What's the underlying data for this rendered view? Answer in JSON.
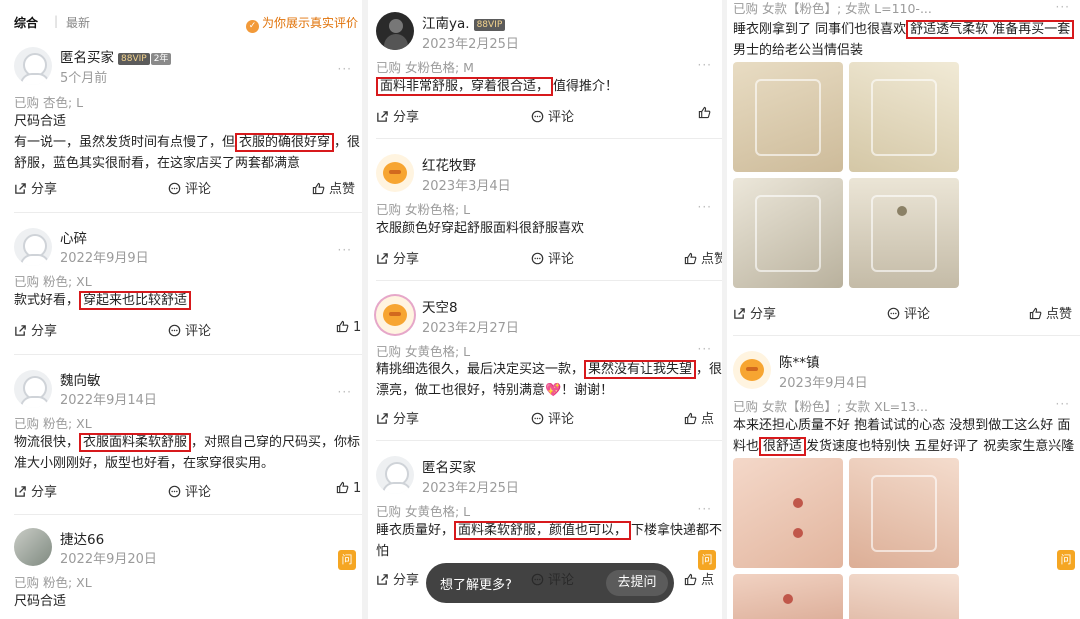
{
  "topbar": {
    "tab_all": "综合",
    "tab_sep": "|",
    "tab_latest": "最新",
    "guarantee": "为你展示真实评价"
  },
  "actions": {
    "share": "分享",
    "comment": "评论",
    "like": "点赞",
    "like_cut": "点赞",
    "like_trunc": "点",
    "like_short": "1"
  },
  "panel1": [
    {
      "user": "匿名买家",
      "vip": "88VIP",
      "vip_level": "2年",
      "date": "5个月前",
      "meta": "已购 杏色; L",
      "line1": "尺码合适",
      "line2_pre": "有一说一，虽然发货时间有点慢了，但",
      "line2_hl": "衣服的确很好穿",
      "line2_post": "，很",
      "line3": "舒服，蓝色其实很耐看，在这家店买了两套都满意"
    },
    {
      "user": "心碎",
      "date": "2022年9月9日",
      "meta": "已购 粉色; XL",
      "line1_pre": "款式好看，",
      "line1_hl": "穿起来也比较舒适"
    },
    {
      "user": "魏向敏",
      "date": "2022年9月14日",
      "meta": "已购 粉色; XL",
      "line1_pre": "物流很快，",
      "line1_hl": "衣服面料柔软舒服",
      "line1_post": "，对照自己穿的尺码买，你标",
      "line2": "准大小刚刚好，版型也好看，在家穿很实用。"
    },
    {
      "user": "捷达66",
      "date": "2022年9月20日",
      "meta": "已购 粉色; XL",
      "line1": "尺码合适"
    }
  ],
  "panel2": [
    {
      "user": "江南ya.",
      "vip": "88VIP",
      "date": "2023年2月25日",
      "meta": "已购 女粉色格; M",
      "line1_hl": "面料非常舒服，穿着很合适，",
      "line1_post": "值得推介！"
    },
    {
      "user": "红花牧野",
      "date": "2023年3月4日",
      "meta": "已购 女粉色格; L",
      "line1": "衣服颜色好穿起舒服面料很舒服喜欢"
    },
    {
      "user": "天空8",
      "date": "2023年2月27日",
      "meta": "已购 女黄色格; L",
      "line1_pre": "精挑细选很久，最后决定买这一款，",
      "line1_hl": "果然没有让我失望",
      "line1_post": "，很",
      "line2": "漂亮，做工也很好，特别满意💖！谢谢！"
    },
    {
      "user": "匿名买家",
      "date": "2023年2月25日",
      "meta": "已购 女黄色格; L",
      "line1_pre": "睡衣质量好，",
      "line1_hl": "面料柔软舒服，颜值也可以，",
      "line1_post": "下楼拿快递都不",
      "line2": "怕"
    }
  ],
  "popup": {
    "question": "想了解更多?",
    "button": "去提问"
  },
  "ask_label": "问",
  "panel3": {
    "top_meta": "已购 女款【粉色】; 女款 L=110-...",
    "top_line1_pre": "睡衣刚拿到了 同事们也很喜欢",
    "top_line1_hl": "舒适透气柔软 准备再买一套",
    "top_line2": "男士的给老公当情侣装",
    "review": {
      "user": "陈**镇",
      "date": "2023年9月4日",
      "meta": "已购 女款【粉色】; 女款 XL=13...",
      "line1": "本来还担心质量不好 抱着试试的心态 没想到做工这么好 面",
      "line2_pre": "料也",
      "line2_hl": "很舒适",
      "line2_post": "发货速度也特别快 五星好评了 祝卖家生意兴隆"
    }
  },
  "colors": {
    "highlight_border": "#d7191c",
    "accent_orange": "#e0730a",
    "meta_gray": "#9b9b9b"
  },
  "icons": [
    "share-icon",
    "comment-icon",
    "like-icon",
    "more-icon",
    "guarantee-icon",
    "ask-icon"
  ]
}
